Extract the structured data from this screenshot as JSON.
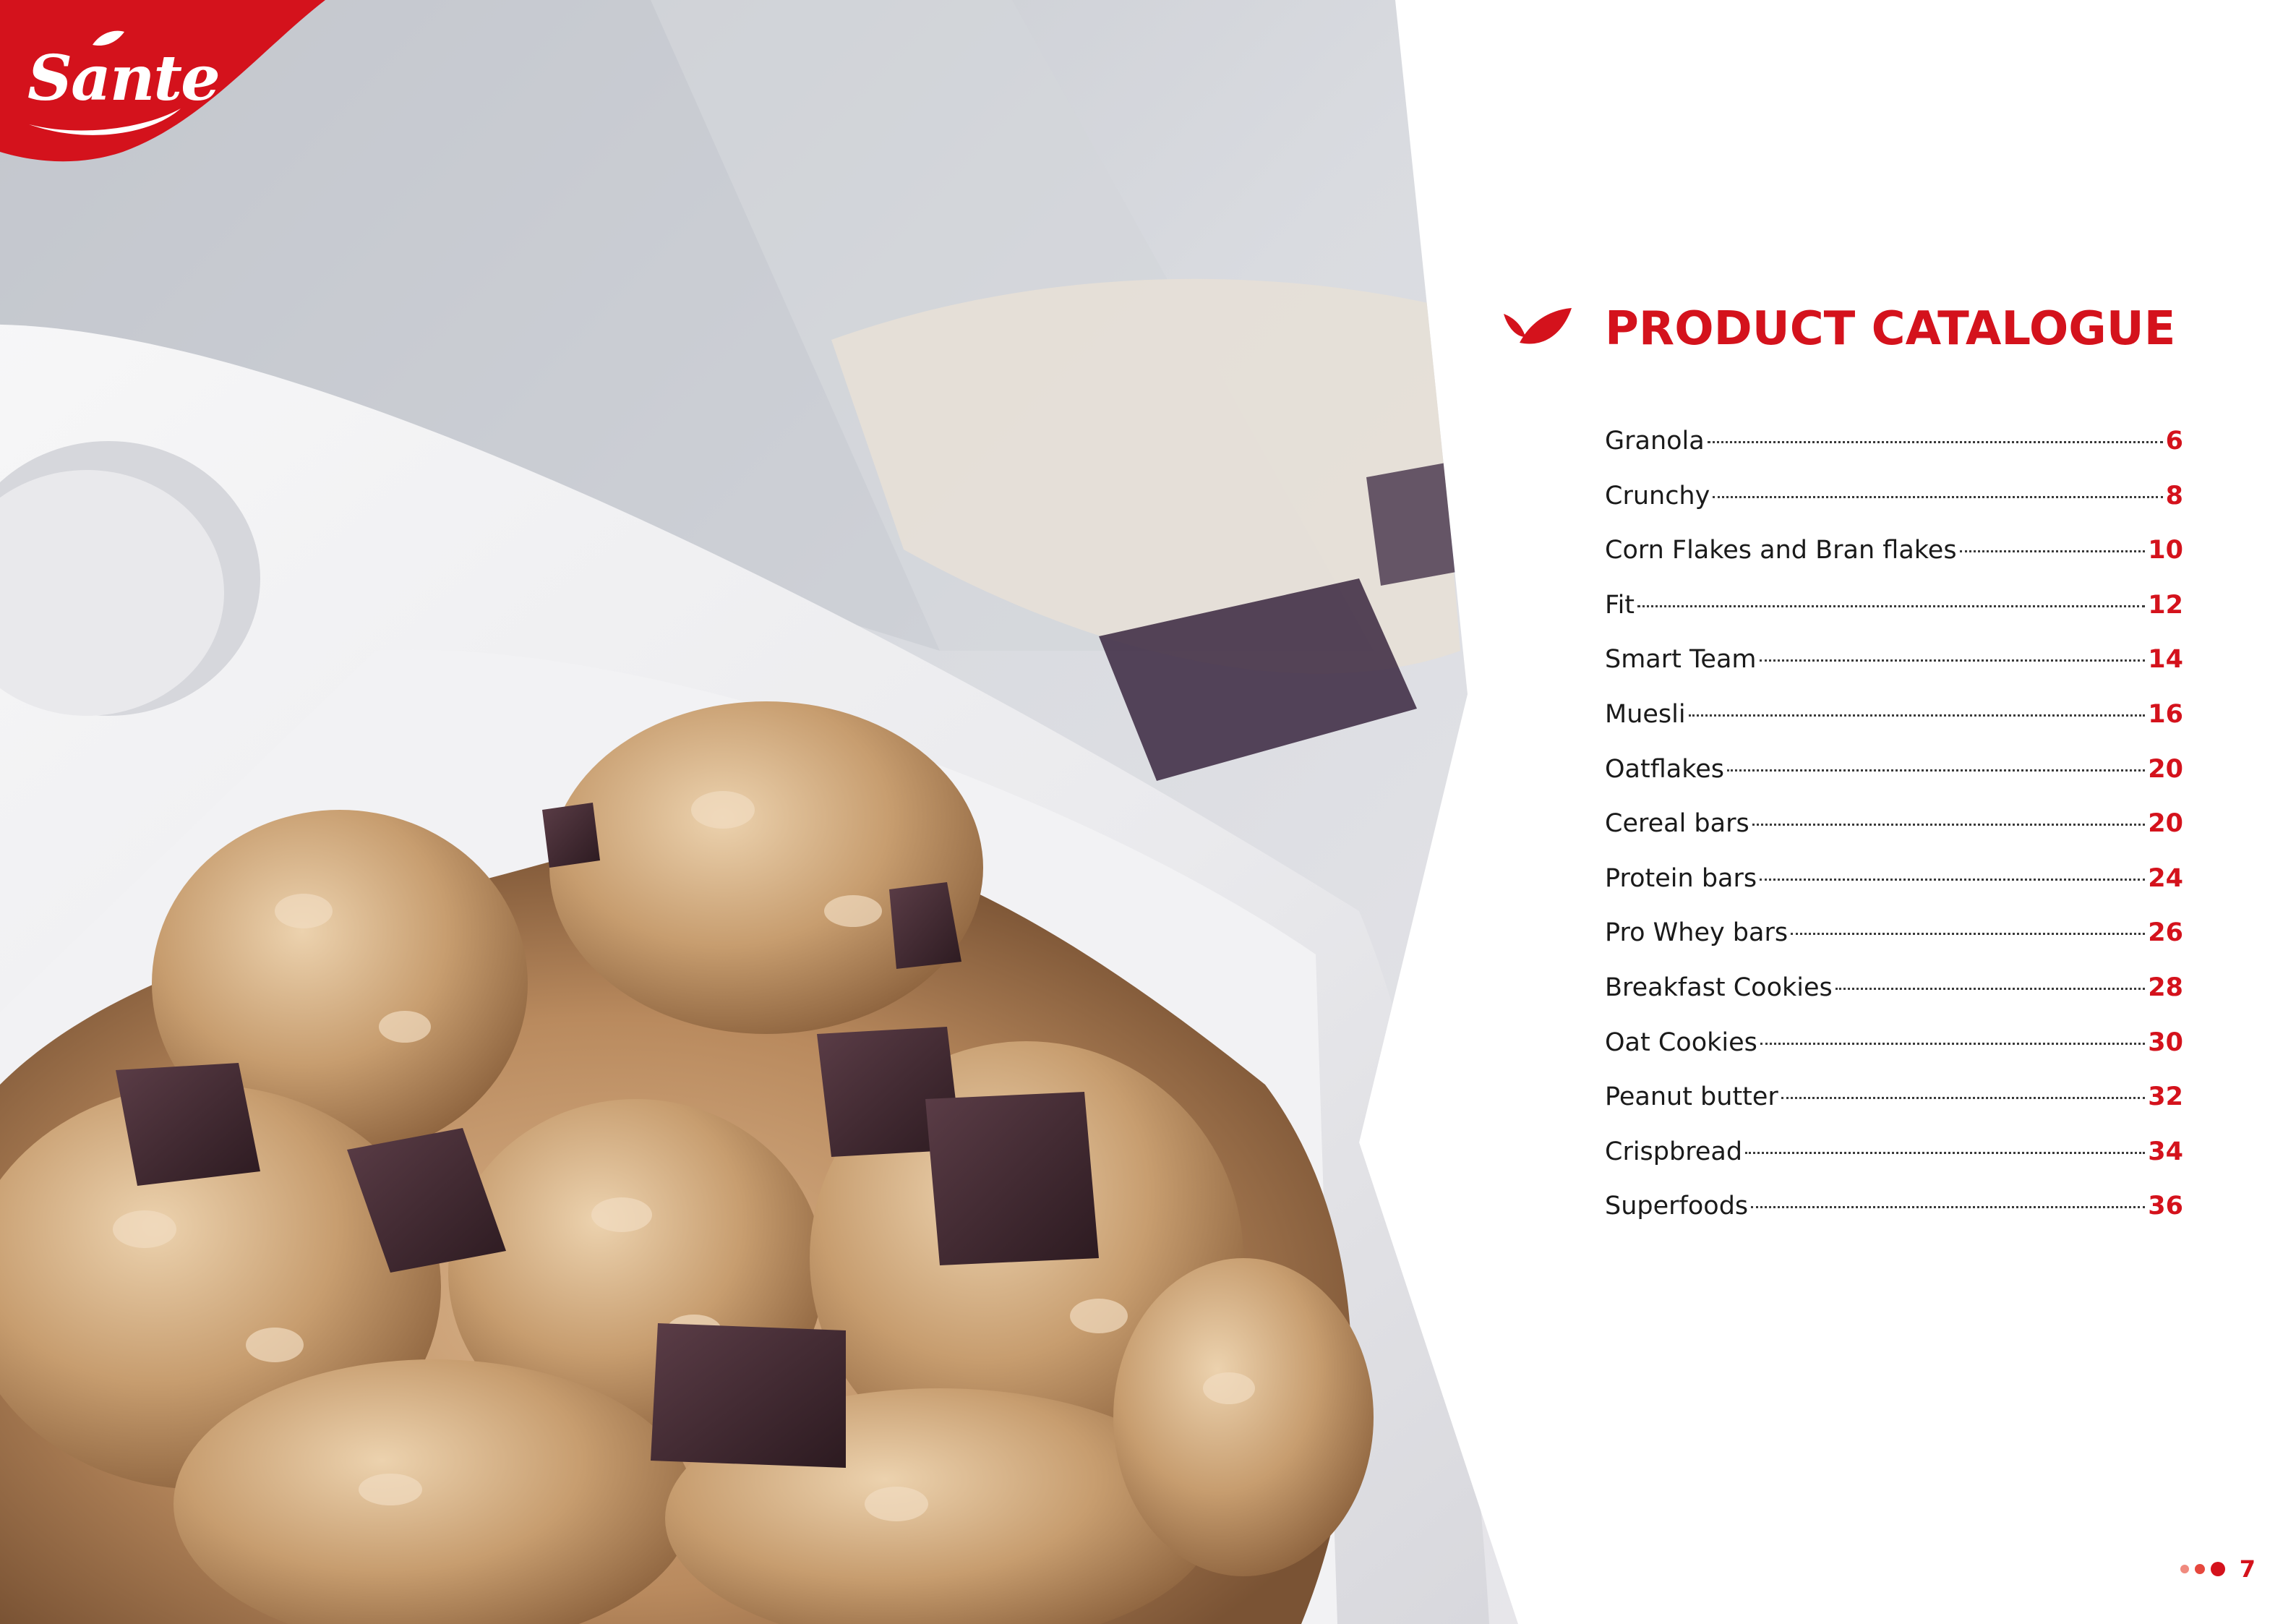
{
  "brand": {
    "logo_text": "Sante",
    "accent_color": "#d4121c"
  },
  "photo": {
    "subject": "granola-with-chocolate-chunks-in-white-bowl"
  },
  "catalogue": {
    "title": "PRODUCT CATALOGUE",
    "icon": "leaf-icon",
    "entries": [
      {
        "label": "Granola",
        "page": "6"
      },
      {
        "label": "Crunchy",
        "page": "8"
      },
      {
        "label": "Corn Flakes and Bran flakes",
        "page": "10"
      },
      {
        "label": "Fit",
        "page": "12"
      },
      {
        "label": "Smart Team",
        "page": "14"
      },
      {
        "label": "Muesli",
        "page": "16"
      },
      {
        "label": "Oatflakes",
        "page": "20"
      },
      {
        "label": "Cereal bars",
        "page": "20"
      },
      {
        "label": "Protein bars",
        "page": "24"
      },
      {
        "label": "Pro Whey bars",
        "page": "26"
      },
      {
        "label": "Breakfast Cookies",
        "page": "28"
      },
      {
        "label": "Oat Cookies",
        "page": "30"
      },
      {
        "label": "Peanut butter",
        "page": "32"
      },
      {
        "label": "Crispbread",
        "page": "34"
      },
      {
        "label": "Superfoods",
        "page": "36"
      }
    ]
  },
  "footer": {
    "page_number": "7"
  }
}
